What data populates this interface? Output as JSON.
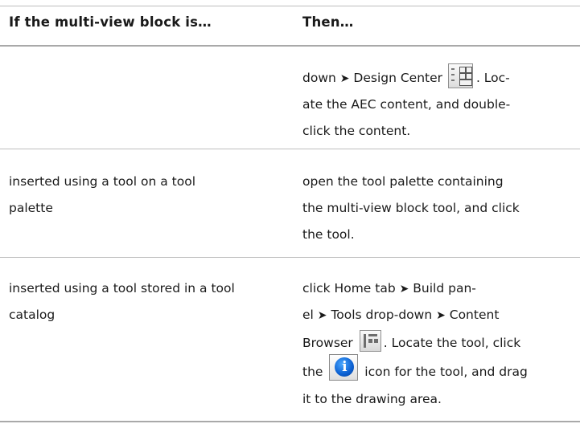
{
  "headers": {
    "col1": "If the multi-view block is…",
    "col2": "Then…"
  },
  "rows": [
    {
      "condition_lines": [],
      "action": {
        "l1_a": "down ",
        "l1_arrow": "➤",
        "l1_b": " Design Center ",
        "l1_c": ". Loc-",
        "l2": "ate the AEC content, and double-",
        "l3": "click the content."
      }
    },
    {
      "condition_lines": [
        "inserted using a tool on a tool",
        "palette"
      ],
      "action": {
        "l1": "open the tool palette containing",
        "l2": "the multi-view block tool, and click",
        "l3": "the tool."
      }
    },
    {
      "condition_lines": [
        "inserted using a tool stored in a tool",
        "catalog"
      ],
      "action": {
        "l1_a": "click Home tab ",
        "l1_arrow": "➤",
        "l1_b": " Build pan-",
        "l2_a": "el ",
        "l2_arrow1": "➤",
        "l2_b": " Tools drop-down ",
        "l2_arrow2": "➤",
        "l2_c": " Content",
        "l3_a": "Browser ",
        "l3_b": ". Locate the tool, click",
        "l4_a": "the ",
        "l4_b": " icon for the tool, and drag",
        "l5": "it to the drawing area."
      }
    }
  ],
  "icons": {
    "design_center": "design-center-icon",
    "content_browser": "content-browser-icon",
    "info": "info-icon",
    "info_glyph": "i"
  }
}
